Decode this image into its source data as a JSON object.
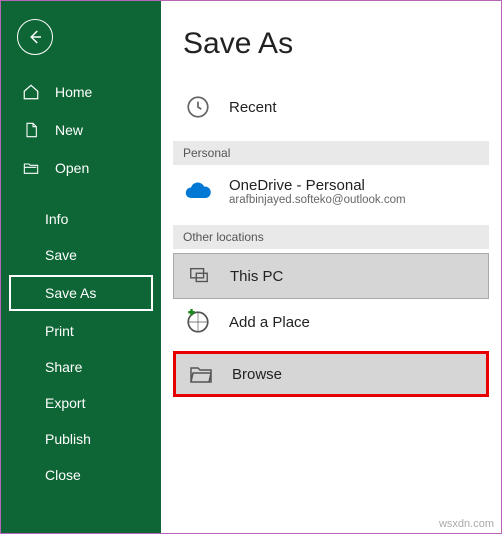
{
  "sidebar": {
    "home": "Home",
    "new": "New",
    "open": "Open",
    "sub": {
      "info": "Info",
      "save": "Save",
      "saveas": "Save As",
      "print": "Print",
      "share": "Share",
      "export": "Export",
      "publish": "Publish",
      "close": "Close"
    }
  },
  "main": {
    "title": "Save As",
    "recent": "Recent",
    "section_personal": "Personal",
    "onedrive_title": "OneDrive - Personal",
    "onedrive_email": "arafbinjayed.softeko@outlook.com",
    "section_other": "Other locations",
    "thispc": "This PC",
    "addplace": "Add a Place",
    "browse": "Browse"
  },
  "watermark": "wsxdn.com"
}
